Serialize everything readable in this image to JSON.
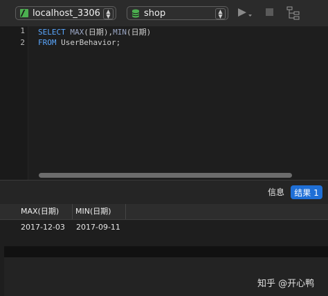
{
  "toolbar": {
    "connection": "localhost_3306",
    "database": "shop"
  },
  "editor": {
    "line_numbers": [
      "1",
      "2"
    ],
    "line1": {
      "kw_select": "SELECT",
      "fn_max": "MAX",
      "arg1": "(日期),",
      "fn_min": "MIN",
      "arg2": "(日期)"
    },
    "line2": {
      "kw_from": "FROM",
      "table": " UserBehavior;"
    }
  },
  "result_tabs": {
    "info": "信息",
    "result": "结果 1"
  },
  "result_grid": {
    "columns": [
      "MAX(日期)",
      "MIN(日期)"
    ],
    "rows": [
      [
        "2017-12-03",
        "2017-09-11"
      ]
    ]
  },
  "watermark": "知乎 @开心鸭",
  "colors": {
    "keyword": "#5aa7ff",
    "accent": "#1f6fd6",
    "connection_icon": "#4caf50"
  }
}
